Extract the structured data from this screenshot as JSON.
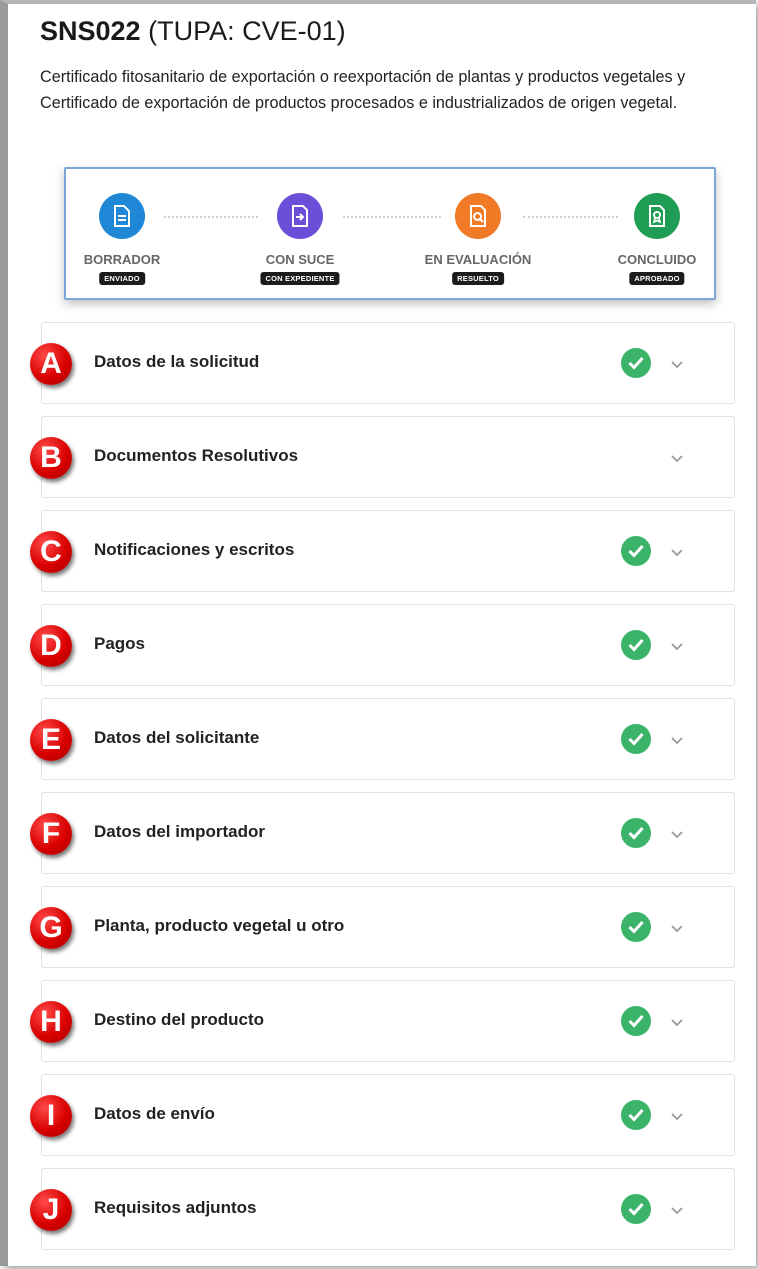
{
  "header": {
    "code": "SNS022",
    "tupa": "(TUPA: CVE-01)",
    "description": "Certificado fitosanitario de exportación o reexportación de plantas y productos vegetales y Certificado de exportación de productos procesados e industrializados de origen vegetal."
  },
  "stepper": {
    "steps": [
      {
        "label": "BORRADOR",
        "badge": "ENVIADO",
        "color": "#1e88d6",
        "icon": "document-icon"
      },
      {
        "label": "CON SUCE",
        "badge": "CON EXPEDIENTE",
        "color": "#6a4fd8",
        "icon": "file-arrow-icon"
      },
      {
        "label": "EN EVALUACIÓN",
        "badge": "RESUELTO",
        "color": "#f07a26",
        "icon": "file-search-icon"
      },
      {
        "label": "CONCLUIDO",
        "badge": "APROBADO",
        "color": "#1f9d55",
        "icon": "file-certificate-icon"
      }
    ]
  },
  "sections": [
    {
      "marker": "A",
      "title": "Datos de la solicitud",
      "complete": true
    },
    {
      "marker": "B",
      "title": "Documentos Resolutivos",
      "complete": false
    },
    {
      "marker": "C",
      "title": "Notificaciones y escritos",
      "complete": true
    },
    {
      "marker": "D",
      "title": "Pagos",
      "complete": true
    },
    {
      "marker": "E",
      "title": "Datos del solicitante",
      "complete": true
    },
    {
      "marker": "F",
      "title": "Datos del importador",
      "complete": true
    },
    {
      "marker": "G",
      "title": "Planta, producto vegetal u otro",
      "complete": true
    },
    {
      "marker": "H",
      "title": "Destino del producto",
      "complete": true
    },
    {
      "marker": "I",
      "title": "Datos de envío",
      "complete": true
    },
    {
      "marker": "J",
      "title": "Requisitos adjuntos",
      "complete": true
    }
  ],
  "colors": {
    "check": "#3bb46a",
    "marker": "#d90000"
  }
}
